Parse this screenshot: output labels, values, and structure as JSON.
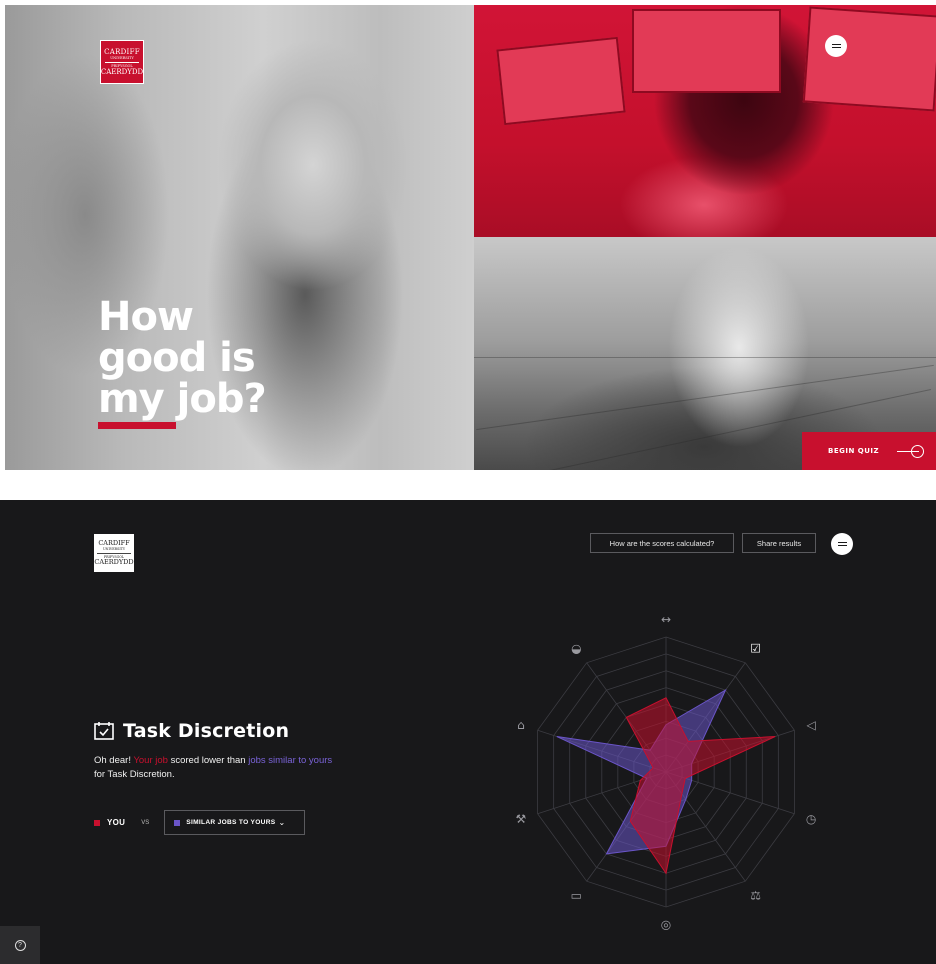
{
  "hero": {
    "logo": {
      "line1": "CARDIFF",
      "line2": "UNIVERSITY",
      "line3": "PRIFYSGOL",
      "line4": "CAERDYDD"
    },
    "title_lines": [
      "How",
      "good is",
      "my job?"
    ],
    "begin_quiz_label": "BEGIN QUIZ"
  },
  "results": {
    "logo": {
      "line1": "CARDIFF",
      "line2": "UNIVERSITY",
      "line3": "PRIFYSGOL",
      "line4": "CAERDYDD"
    },
    "header": {
      "scores_button": "How are the scores calculated?",
      "share_button": "Share results"
    },
    "dimension_title": "Task Discretion",
    "description": {
      "part1": "Oh dear! ",
      "part2": "Your job",
      "part3": " scored lower than ",
      "part4": "jobs similar to yours",
      "part5": " for Task Discretion."
    },
    "legend": {
      "you_label": "YOU",
      "vs_label": "VS",
      "similar_label": "SIMILAR JOBS TO YOURS",
      "you_color": "#c8102e",
      "similar_color": "#6a55c8"
    },
    "radar": {
      "axes_icons": [
        "dumbbell-icon",
        "checklist-icon",
        "megaphone-icon",
        "clock-icon",
        "scales-icon",
        "lifebuoy-icon",
        "money-icon",
        "tools-icon",
        "lock-icon",
        "piggy-bank-icon"
      ],
      "levels": 8,
      "highlighted_axis": "checklist-icon",
      "you_values": [
        0.55,
        0.28,
        0.85,
        0.15,
        0.2,
        0.75,
        0.45,
        0.2,
        0.1,
        0.5
      ],
      "similar_values": [
        0.35,
        0.75,
        0.2,
        0.2,
        0.25,
        0.55,
        0.75,
        0.15,
        0.85,
        0.2
      ]
    }
  }
}
